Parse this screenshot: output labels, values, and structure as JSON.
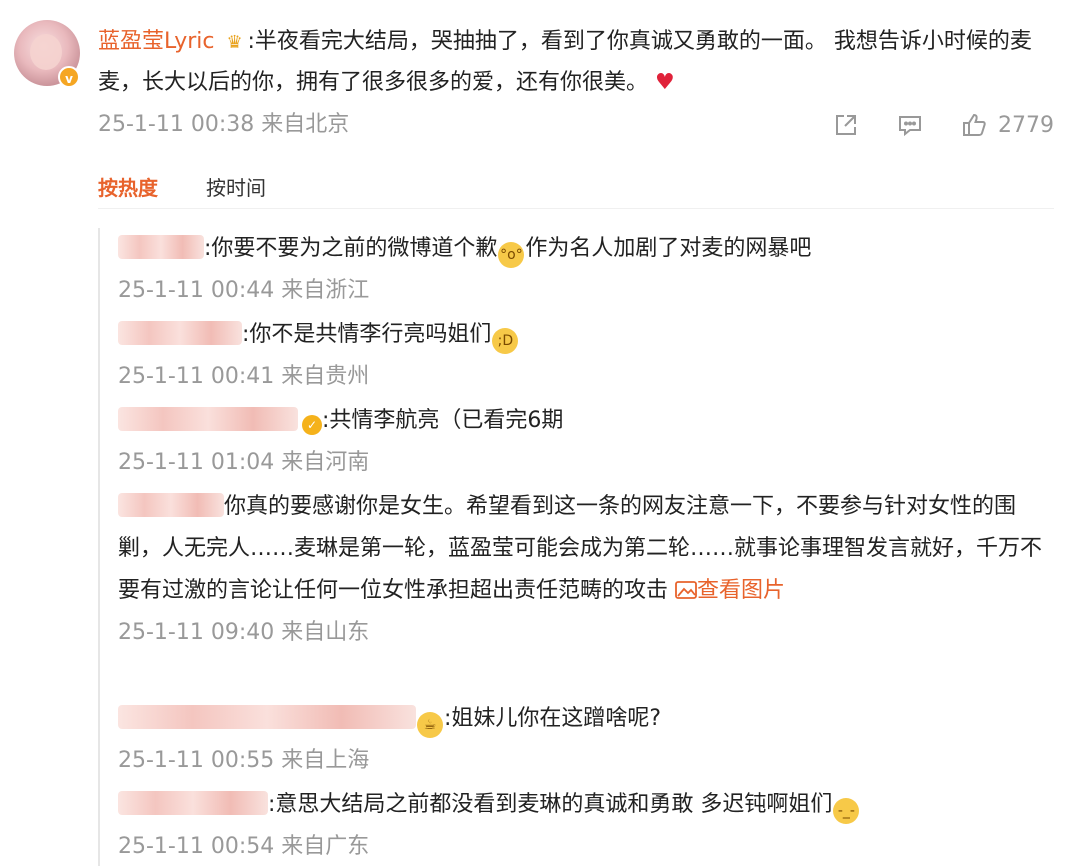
{
  "post": {
    "author": "蓝盈莹Lyric",
    "text": ":半夜看完大结局，哭抽抽了，看到了你真诚又勇敢的一面。 我想告诉小时候的麦麦，长大以后的你，拥有了很多很多的爱，还有你很美。",
    "timestamp": "25-1-11 00:38 来自北京",
    "likes": "2779",
    "icons": [
      "share-icon",
      "comment-icon",
      "like-icon",
      "crown-icon",
      "heart-icon"
    ]
  },
  "sort": {
    "hot": "按热度",
    "time": "按时间"
  },
  "replies": [
    {
      "pre": ":你要不要为之前的微博道个歉",
      "post": "作为名人加剧了对麦的网暴吧",
      "meta": "25-1-11 00:44 来自浙江"
    },
    {
      "pre": ":你不是共情李行亮吗姐们",
      "post": "",
      "meta": "25-1-11 00:41 来自贵州"
    },
    {
      "pre": ":共情李航亮（已看完6期",
      "post": "",
      "meta": "25-1-11 01:04 来自河南"
    },
    {
      "pre": "你真的要感谢你是女生。希望看到这一条的网友注意一下，不要参与针对女性的围剿，人无完人……麦琳是第一轮，蓝盈莹可能会成为第二轮……就事论事理智发言就好，千万不要有过激的言论让任何一位女性承担超出责任范畴的攻击",
      "link": "查看图片",
      "meta": "25-1-11 09:40 来自山东"
    },
    {
      "pre": ":姐妹儿你在这蹭啥呢?",
      "post": "",
      "meta": "25-1-11 00:55 来自上海"
    },
    {
      "pre": ":意思大结局之前都没看到麦琳的真诚和勇敢 多迟钝啊姐们",
      "post": "",
      "meta": "25-1-11 00:54 来自广东"
    }
  ]
}
